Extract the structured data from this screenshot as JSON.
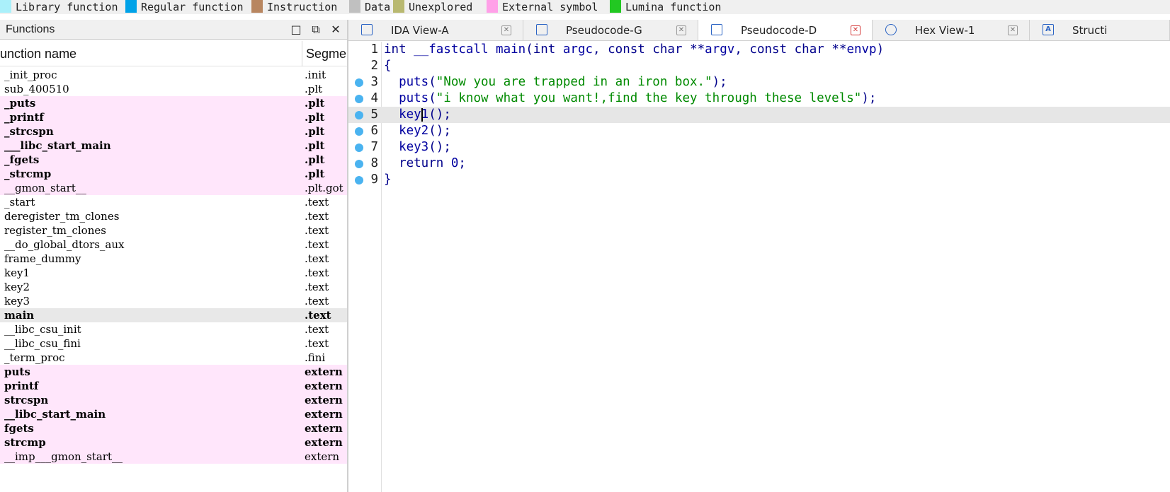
{
  "legend": [
    {
      "label": "Library function",
      "color": "#aaf0fa"
    },
    {
      "label": "Regular function",
      "color": "#00a2e8"
    },
    {
      "label": "Instruction",
      "color": "#b88660"
    },
    {
      "label": "Data",
      "color": "#c0c0c0"
    },
    {
      "label": "Unexplored",
      "color": "#b8b870"
    },
    {
      "label": "External symbol",
      "color": "#ffa0e8"
    },
    {
      "label": "Lumina function",
      "color": "#22c822"
    }
  ],
  "functions_panel": {
    "title": "Functions",
    "col_name": "unction name",
    "col_segment": "Segme",
    "rows": [
      {
        "name": "_init_proc",
        "segment": ".init",
        "kind": "normal"
      },
      {
        "name": "sub_400510",
        "segment": ".plt",
        "kind": "normal"
      },
      {
        "name": "_puts",
        "segment": ".plt",
        "kind": "ext-bold"
      },
      {
        "name": "_printf",
        "segment": ".plt",
        "kind": "ext-bold"
      },
      {
        "name": "_strcspn",
        "segment": ".plt",
        "kind": "ext-bold"
      },
      {
        "name": "___libc_start_main",
        "segment": ".plt",
        "kind": "ext-bold"
      },
      {
        "name": "_fgets",
        "segment": ".plt",
        "kind": "ext-bold"
      },
      {
        "name": "_strcmp",
        "segment": ".plt",
        "kind": "ext-bold"
      },
      {
        "name": "__gmon_start__",
        "segment": ".plt.got",
        "kind": "ext"
      },
      {
        "name": "_start",
        "segment": ".text",
        "kind": "normal"
      },
      {
        "name": "deregister_tm_clones",
        "segment": ".text",
        "kind": "normal"
      },
      {
        "name": "register_tm_clones",
        "segment": ".text",
        "kind": "normal"
      },
      {
        "name": "__do_global_dtors_aux",
        "segment": ".text",
        "kind": "normal"
      },
      {
        "name": "frame_dummy",
        "segment": ".text",
        "kind": "normal"
      },
      {
        "name": "key1",
        "segment": ".text",
        "kind": "normal"
      },
      {
        "name": "key2",
        "segment": ".text",
        "kind": "normal"
      },
      {
        "name": "key3",
        "segment": ".text",
        "kind": "normal"
      },
      {
        "name": "main",
        "segment": ".text",
        "kind": "selected"
      },
      {
        "name": "__libc_csu_init",
        "segment": ".text",
        "kind": "normal"
      },
      {
        "name": "__libc_csu_fini",
        "segment": ".text",
        "kind": "normal"
      },
      {
        "name": "_term_proc",
        "segment": ".fini",
        "kind": "normal"
      },
      {
        "name": "puts",
        "segment": "extern",
        "kind": "ext-bold"
      },
      {
        "name": "printf",
        "segment": "extern",
        "kind": "ext-bold"
      },
      {
        "name": "strcspn",
        "segment": "extern",
        "kind": "ext-bold"
      },
      {
        "name": "__libc_start_main",
        "segment": "extern",
        "kind": "ext-bold"
      },
      {
        "name": "fgets",
        "segment": "extern",
        "kind": "ext-bold"
      },
      {
        "name": "strcmp",
        "segment": "extern",
        "kind": "ext-bold"
      },
      {
        "name": "__imp___gmon_start__",
        "segment": "extern",
        "kind": "ext"
      }
    ]
  },
  "tabs": [
    {
      "label": "IDA View-A",
      "icon": "view-icon",
      "active": false
    },
    {
      "label": "Pseudocode-G",
      "icon": "view-icon",
      "active": false
    },
    {
      "label": "Pseudocode-D",
      "icon": "view-icon",
      "active": true
    },
    {
      "label": "Hex View-1",
      "icon": "hex-icon",
      "active": false
    },
    {
      "label": "Structi",
      "icon": "struct-icon",
      "active": false
    }
  ],
  "code": {
    "lines": [
      {
        "num": "1",
        "text": "int __fastcall main(int argc, const char **argv, const char **envp)",
        "bp": false,
        "hl": false
      },
      {
        "num": "2",
        "text": "{",
        "bp": false,
        "hl": false
      },
      {
        "num": "3",
        "text": "  puts(\"Now you are trapped in an iron box.\");",
        "bp": true,
        "hl": false
      },
      {
        "num": "4",
        "text": "  puts(\"i know what you want!,find the key through these levels\");",
        "bp": true,
        "hl": false
      },
      {
        "num": "5",
        "text": "  key1();",
        "bp": true,
        "hl": true
      },
      {
        "num": "6",
        "text": "  key2();",
        "bp": true,
        "hl": false
      },
      {
        "num": "7",
        "text": "  key3();",
        "bp": true,
        "hl": false
      },
      {
        "num": "8",
        "text": "  return 0;",
        "bp": true,
        "hl": false
      },
      {
        "num": "9",
        "text": "}",
        "bp": true,
        "hl": false
      }
    ],
    "caret": {
      "line": "5",
      "col": 5
    }
  }
}
